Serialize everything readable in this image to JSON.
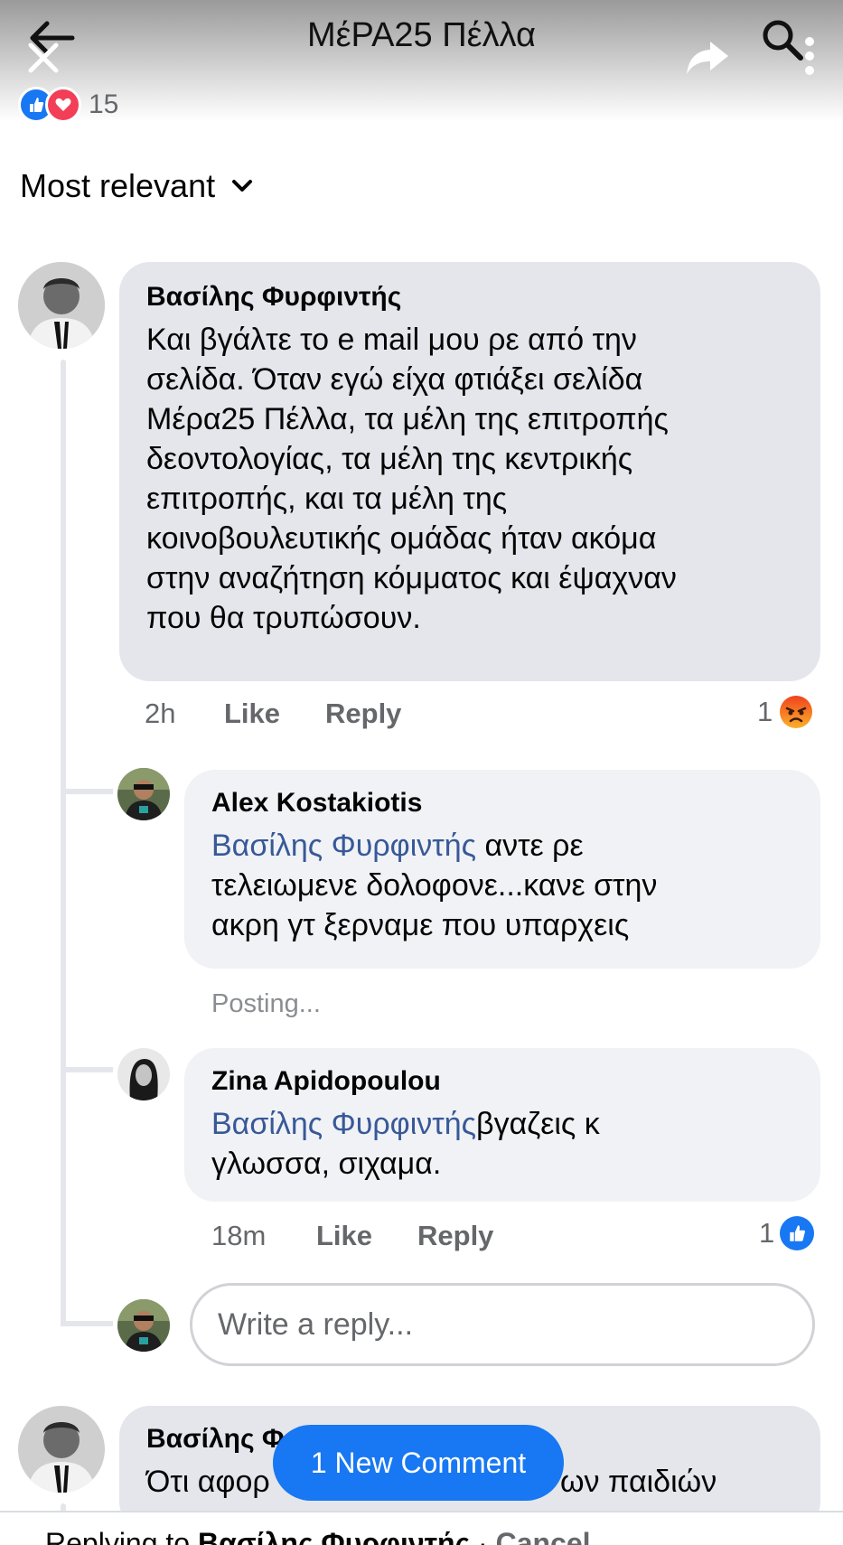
{
  "header": {
    "title": "ΜέΡΑ25 Πέλλα",
    "reaction_count": "15"
  },
  "sort": {
    "label": "Most relevant"
  },
  "comments": [
    {
      "author": "Βασίλης Φυρφιντής",
      "text_lines": [
        "Και βγάλτε το e mail μου ρε  από την",
        "σελίδα. Όταν εγώ είχα φτιάξει σελίδα",
        "Μέρα25 Πέλλα, τα μέλη της επιτροπής",
        "δεοντολογίας, τα μέλη  της κεντρικής",
        "επιτροπής, και τα μέλη της",
        "κοινοβουλευτικής ομάδας  ήταν ακόμα",
        "στην αναζήτηση κόμματος και έψαχναν",
        "που θα τρυπώσουν."
      ],
      "time": "2h",
      "like_label": "Like",
      "reply_label": "Reply",
      "reaction_count": "1",
      "replies": [
        {
          "author": "Alex Kostakiotis",
          "mention": "Βασίλης Φυρφιντής",
          "text_first": " αντε ρε",
          "text_lines": [
            "τελειωμενε δολοφονε...κανε στην",
            "ακρη γτ ξερναμε που υπαρχεις"
          ],
          "status": "Posting..."
        },
        {
          "author": "Zina Apidopoulou",
          "mention": "Βασίλης Φυρφιντής",
          "text_first": "βγαζεις κ",
          "text_lines": [
            "γλωσσα, σιχαμα."
          ],
          "time": "18m",
          "like_label": "Like",
          "reply_label": "Reply",
          "reaction_count": "1"
        }
      ],
      "reply_placeholder": "Write a reply..."
    },
    {
      "author": "Βασίλης Φ",
      "text_start": "Ότι αφορ",
      "text_end": "ων παιδιών"
    }
  ],
  "new_comment_label": "1 New Comment",
  "reply_bar": {
    "prefix": "Replying to ",
    "name": "Βασίλης Φυρφιντής",
    "separator": " · ",
    "cancel": "Cancel"
  }
}
